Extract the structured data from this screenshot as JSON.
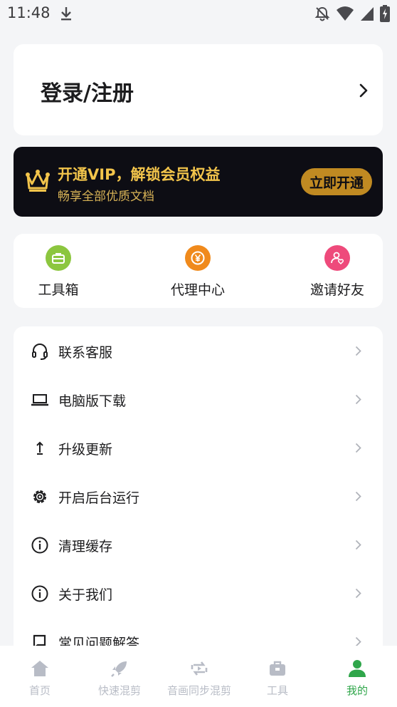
{
  "status_bar": {
    "time": "11:48",
    "icons": [
      "download-icon",
      "bell-off-icon",
      "wifi-icon",
      "signal-icon",
      "battery-charging-icon"
    ]
  },
  "login": {
    "title": "登录/注册",
    "icon": "chevron-right-icon"
  },
  "vip": {
    "title": "开通VIP，解锁会员权益",
    "subtitle": "畅享全部优质文档",
    "button": "立即开通",
    "icon": "crown-icon",
    "colors": {
      "background": "#0d0d14",
      "accent": "#f2c44b",
      "button": "#c08a22"
    }
  },
  "quick_actions": [
    {
      "label": "工具箱",
      "icon": "toolbox-icon",
      "color": "#8cc63f"
    },
    {
      "label": "代理中心",
      "icon": "yen-coin-icon",
      "color": "#f08a1c"
    },
    {
      "label": "邀请好友",
      "icon": "invite-friend-icon",
      "color": "#ee4a7b"
    }
  ],
  "menu": [
    {
      "label": "联系客服",
      "icon": "headset-icon"
    },
    {
      "label": "电脑版下载",
      "icon": "laptop-icon"
    },
    {
      "label": "升级更新",
      "icon": "arrow-up-icon"
    },
    {
      "label": "开启后台运行",
      "icon": "gear-icon"
    },
    {
      "label": "清理缓存",
      "icon": "info-icon"
    },
    {
      "label": "关于我们",
      "icon": "info-icon"
    },
    {
      "label": "常见问题解答",
      "icon": "faq-icon"
    }
  ],
  "bottom_nav": {
    "active_color": "#2fa64a",
    "inactive_color": "#b8bcc6",
    "items": [
      {
        "label": "首页",
        "icon": "home-icon",
        "active": false
      },
      {
        "label": "快速混剪",
        "icon": "rocket-icon",
        "active": false
      },
      {
        "label": "音画同步混剪",
        "icon": "sync-icon",
        "active": false
      },
      {
        "label": "工具",
        "icon": "toolbox-icon",
        "active": false
      },
      {
        "label": "我的",
        "icon": "user-icon",
        "active": true
      }
    ]
  }
}
